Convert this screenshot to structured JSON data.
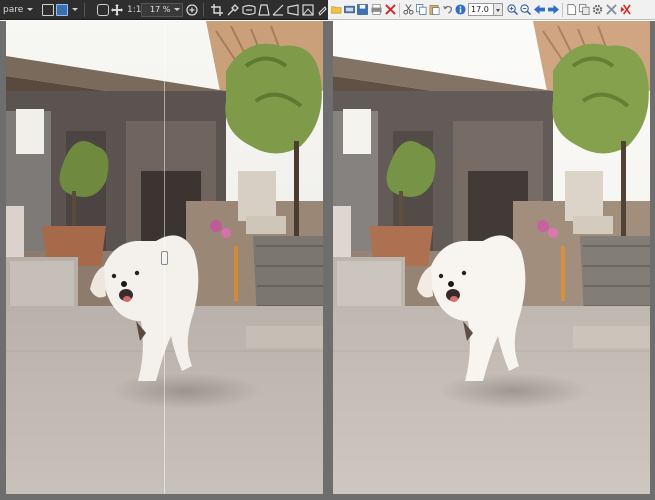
{
  "left_toolbar": {
    "tool_label": "pare",
    "zoom_1to1_label": "1:1",
    "zoom_value": "17 %"
  },
  "right_toolbar": {
    "zoom_value": "17.0"
  },
  "colors": {
    "dark_toolbar_bg": "#2e2e2e",
    "light_toolbar_bg": "#f1f1f1",
    "divider_gray": "#6e6e6e",
    "active_tool_blue": "#3d6fa8"
  },
  "icons": {
    "left": [
      "compare-dropdown",
      "single-view-icon",
      "split-view-icon",
      "crop-frame-icon",
      "move-icon",
      "zoom-in-icon",
      "crop-icon",
      "eyedropper-icon",
      "lens-correction-icon",
      "perspective-icon",
      "straighten-icon",
      "transform-icon",
      "shape-icon",
      "rotate-icon"
    ],
    "right": [
      "open-folder-icon",
      "film-strip-icon",
      "save-icon",
      "print-icon",
      "delete-icon",
      "cut-icon",
      "copy-icon",
      "paste-icon",
      "undo-icon",
      "info-icon",
      "zoom-in-icon",
      "zoom-out-icon",
      "prev-arrow-icon",
      "next-arrow-icon",
      "page-icon",
      "copy-to-icon",
      "settings-icon",
      "tools-icon",
      "exit-icon"
    ]
  }
}
